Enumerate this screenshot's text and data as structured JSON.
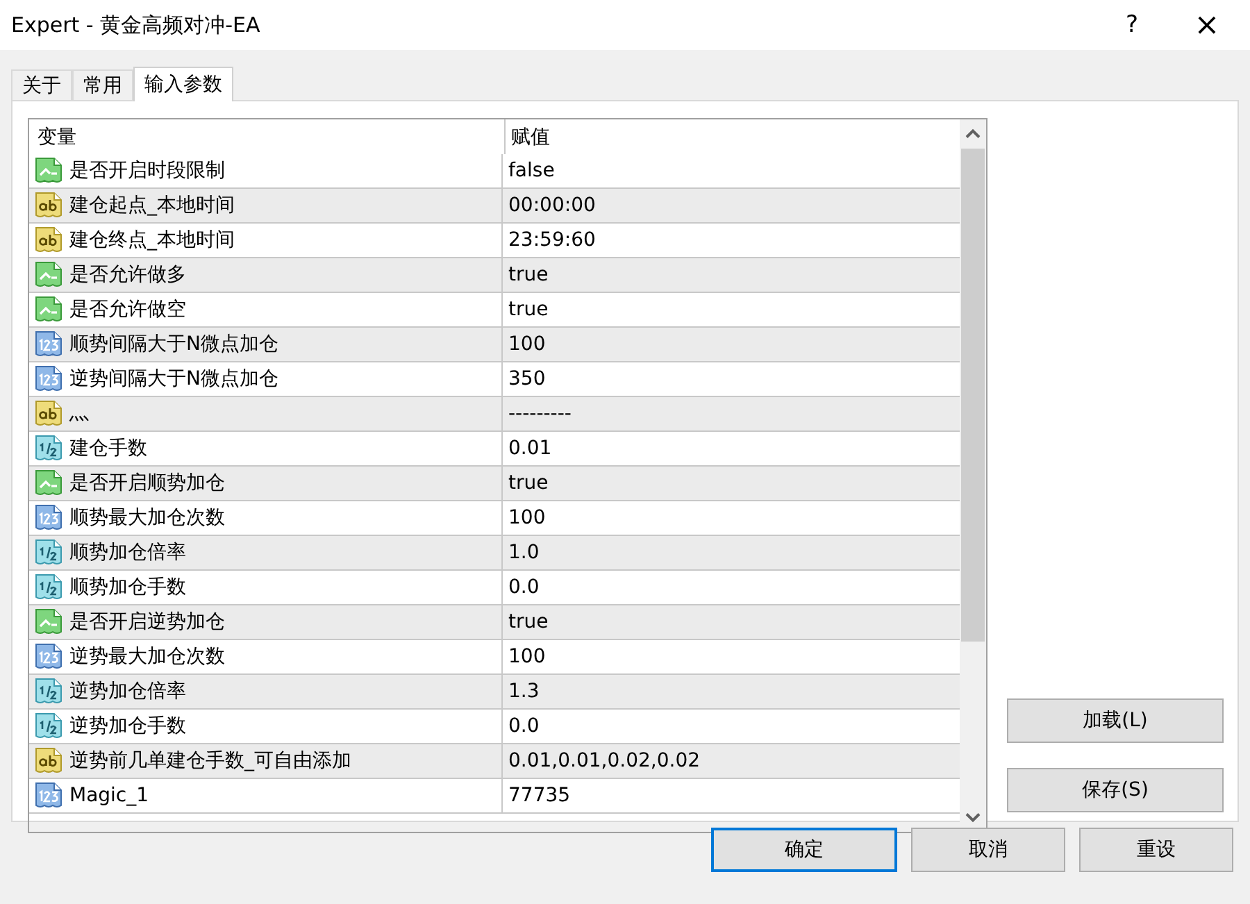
{
  "window": {
    "title": "Expert - 黄金高频对冲-EA",
    "help": "?",
    "close": "×"
  },
  "tabs": [
    {
      "label": "关于",
      "selected": false
    },
    {
      "label": "常用",
      "selected": false
    },
    {
      "label": "输入参数",
      "selected": true
    }
  ],
  "table": {
    "columns": [
      "变量",
      "赋值"
    ],
    "rows": [
      {
        "kind": "bool",
        "name": "是否开启时段限制",
        "value": "false"
      },
      {
        "kind": "string",
        "name": "建仓起点_本地时间",
        "value": "00:00:00"
      },
      {
        "kind": "string",
        "name": "建仓终点_本地时间",
        "value": "23:59:60"
      },
      {
        "kind": "bool",
        "name": "是否允许做多",
        "value": "true"
      },
      {
        "kind": "bool",
        "name": "是否允许做空",
        "value": "true"
      },
      {
        "kind": "int",
        "name": "顺势间隔大于N微点加仓",
        "value": "100"
      },
      {
        "kind": "int",
        "name": "逆势间隔大于N微点加仓",
        "value": "350"
      },
      {
        "kind": "string",
        "name": "灬",
        "value": "---------"
      },
      {
        "kind": "double",
        "name": "建仓手数",
        "value": "0.01"
      },
      {
        "kind": "bool",
        "name": "是否开启顺势加仓",
        "value": "true"
      },
      {
        "kind": "int",
        "name": "顺势最大加仓次数",
        "value": "100"
      },
      {
        "kind": "double",
        "name": "顺势加仓倍率",
        "value": "1.0"
      },
      {
        "kind": "double",
        "name": "顺势加仓手数",
        "value": "0.0"
      },
      {
        "kind": "bool",
        "name": "是否开启逆势加仓",
        "value": "true"
      },
      {
        "kind": "int",
        "name": "逆势最大加仓次数",
        "value": "100"
      },
      {
        "kind": "double",
        "name": "逆势加仓倍率",
        "value": "1.3"
      },
      {
        "kind": "double",
        "name": "逆势加仓手数",
        "value": "0.0"
      },
      {
        "kind": "string",
        "name": "逆势前几单建仓手数_可自由添加",
        "value": "0.01,0.01,0.02,0.02"
      },
      {
        "kind": "int",
        "name": "Magic_1",
        "value": "77735"
      }
    ]
  },
  "side_buttons": [
    "加载(L)",
    "保存(S)"
  ],
  "footer_buttons": [
    {
      "label": "确定",
      "default": true
    },
    {
      "label": "取消",
      "default": false
    },
    {
      "label": "重设",
      "default": false
    }
  ]
}
